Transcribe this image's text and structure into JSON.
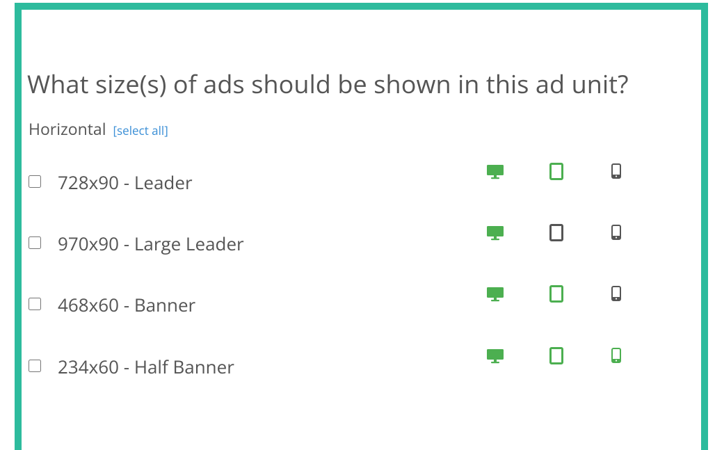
{
  "question": "What size(s) of ads should be shown in this ad unit?",
  "group": {
    "label": "Horizontal",
    "select_all": "[select all]"
  },
  "colors": {
    "frame": "#2dbb9d",
    "enabled_icon": "#4caf50",
    "disabled_icon": "#555555",
    "link": "#3b8fd6"
  },
  "sizes": [
    {
      "label": "728x90 - Leader",
      "checked": false,
      "desktop": true,
      "tablet": true,
      "phone": false
    },
    {
      "label": "970x90 - Large Leader",
      "checked": false,
      "desktop": true,
      "tablet": false,
      "phone": false
    },
    {
      "label": "468x60 - Banner",
      "checked": false,
      "desktop": true,
      "tablet": true,
      "phone": false
    },
    {
      "label": "234x60 - Half Banner",
      "checked": false,
      "desktop": true,
      "tablet": true,
      "phone": true
    }
  ]
}
